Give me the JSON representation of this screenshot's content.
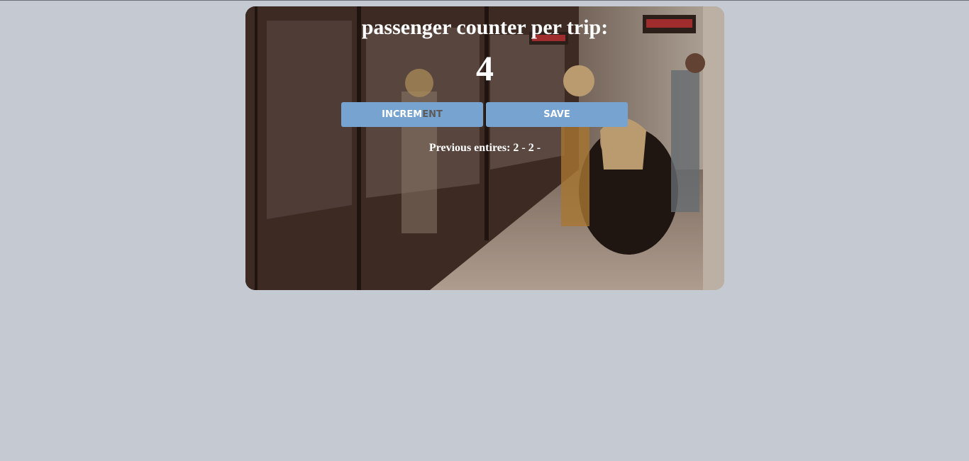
{
  "app": {
    "title": "passenger counter per trip:",
    "count": "4",
    "increment_label_head": "INCREM",
    "increment_label_tail": "ENT",
    "save_label": "SAVE",
    "previous_entries": "Previous entires: 2 - 2 -"
  },
  "colors": {
    "page_background": "#c5c9d2",
    "button_background": "#76a3d0",
    "text": "#ffffff"
  }
}
